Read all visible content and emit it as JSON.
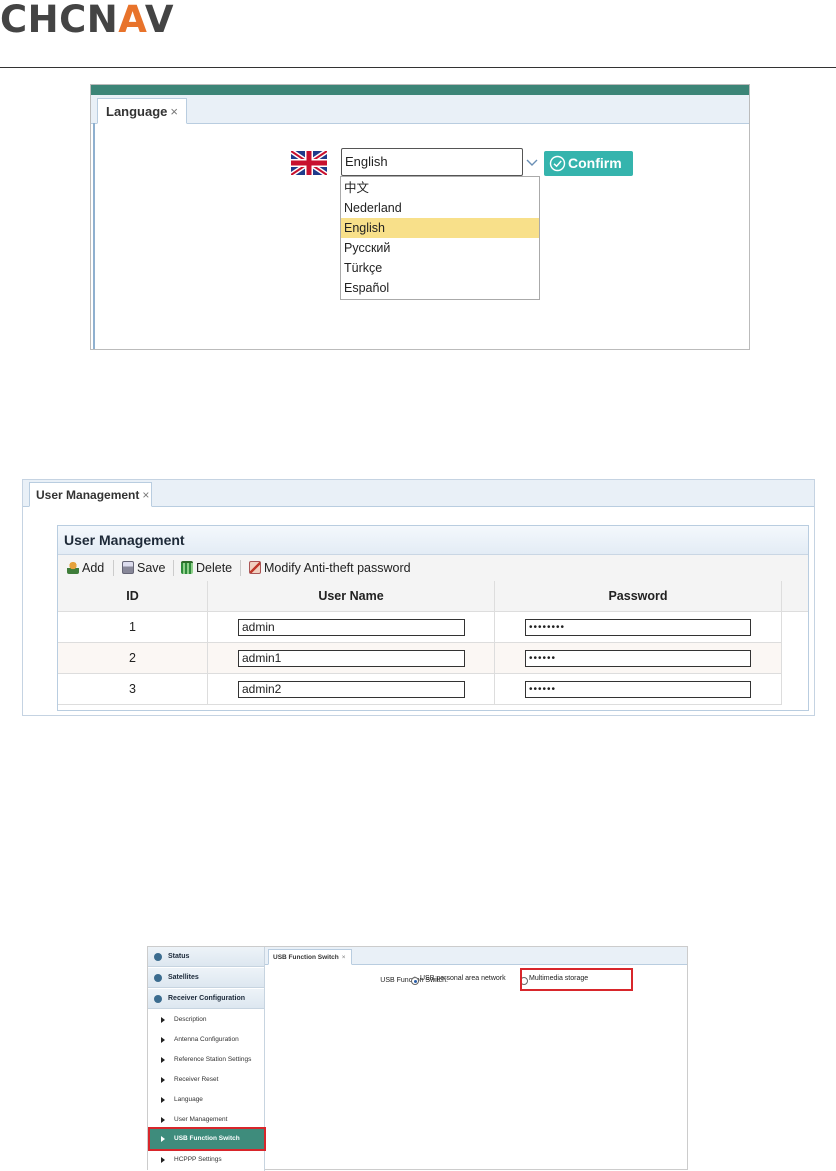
{
  "header": {
    "logo_text_1": "CHCN",
    "logo_text_2": "A",
    "logo_text_3": "V"
  },
  "language_panel": {
    "tab_label": "Language",
    "tab_close": "×",
    "flag_icon": "uk-flag-icon",
    "selected_language": "English",
    "confirm_label": "Confirm",
    "options": [
      "中文",
      "Nederland",
      "English",
      "Русский",
      "Türkçe",
      "Español"
    ],
    "highlighted_option": "English",
    "accent_color": "#35b4ad",
    "highlight_color": "#f8e08a"
  },
  "user_management_panel": {
    "tab_label": "User Management",
    "tab_close": "×",
    "title": "User Management",
    "toolbar": {
      "add": "Add",
      "save": "Save",
      "delete": "Delete",
      "modify": "Modify Anti-theft password"
    },
    "columns": [
      "ID",
      "User Name",
      "Password"
    ],
    "rows": [
      {
        "id": "1",
        "user": "admin",
        "password": "••••••••"
      },
      {
        "id": "2",
        "user": "admin1",
        "password": "••••••"
      },
      {
        "id": "3",
        "user": "admin2",
        "password": "••••••"
      }
    ]
  },
  "usb_panel": {
    "sidebar": {
      "headers": [
        "Status",
        "Satellites",
        "Receiver Configuration"
      ],
      "items": [
        "Description",
        "Antenna Configuration",
        "Reference Station Settings",
        "Receiver Reset",
        "Language",
        "User Management",
        "USB Function Switch",
        "HCPPP Settings"
      ],
      "active_item": "USB Function Switch",
      "active_color": "#3e8c7c"
    },
    "tab_label": "USB Function Switch",
    "tab_close": "×",
    "switch_label": "USB Function Switch:",
    "options": [
      "USB personal area network",
      "Multimedia storage"
    ],
    "selected_option": "USB personal area network",
    "highlight_border_color": "#d8262b"
  }
}
